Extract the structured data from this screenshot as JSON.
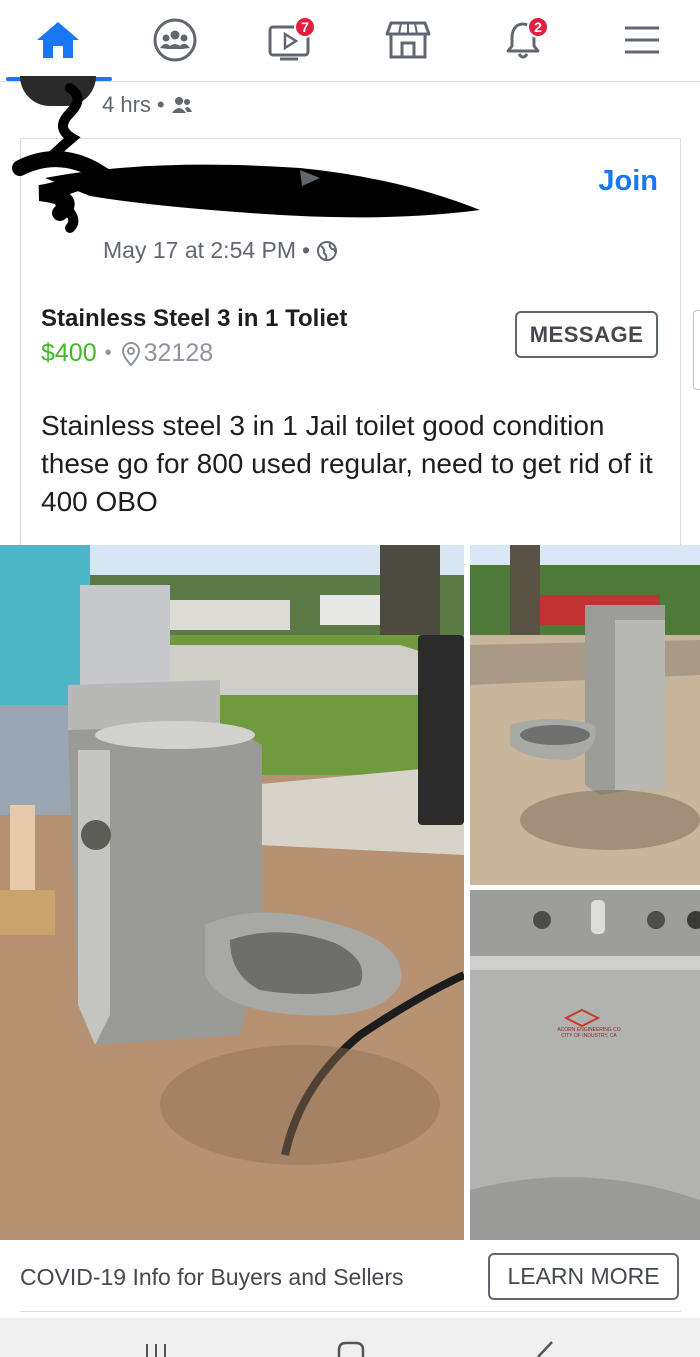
{
  "nav": {
    "items": [
      {
        "name": "home",
        "icon": "home-icon",
        "active": true
      },
      {
        "name": "groups",
        "icon": "groups-icon"
      },
      {
        "name": "watch",
        "icon": "watch-icon",
        "badge": "7"
      },
      {
        "name": "marketplace",
        "icon": "marketplace-icon"
      },
      {
        "name": "notifications",
        "icon": "bell-icon",
        "badge": "2"
      },
      {
        "name": "menu",
        "icon": "hamburger-menu-icon"
      }
    ],
    "accent": "#1877f2",
    "badge_color": "#e41e3f"
  },
  "shared_post": {
    "time": "4 hrs",
    "audience_icon": "friends-icon"
  },
  "listing": {
    "join_label": "Join",
    "date": "May 17 at 2:54 PM",
    "privacy_icon": "globe-icon",
    "title": "Stainless Steel 3 in 1 Toliet",
    "price": "$400",
    "price_color": "#42b72a",
    "location_icon": "location-pin-icon",
    "location": "32128",
    "message_label": "MESSAGE",
    "description": "Stainless steel 3 in 1 Jail toilet good condition these go for 800 used regular, need to get rid of it 400 OBO"
  },
  "photos": {
    "plate_text_line1": "ACORN ENGINEERING CO",
    "plate_text_line2": "CITY OF INDUSTRY, CA"
  },
  "banner": {
    "text": "COVID-19 Info for Buyers and Sellers",
    "button_label": "LEARN MORE"
  },
  "system_nav": {
    "items": [
      "recents-icon",
      "home-button-icon",
      "back-icon"
    ]
  }
}
